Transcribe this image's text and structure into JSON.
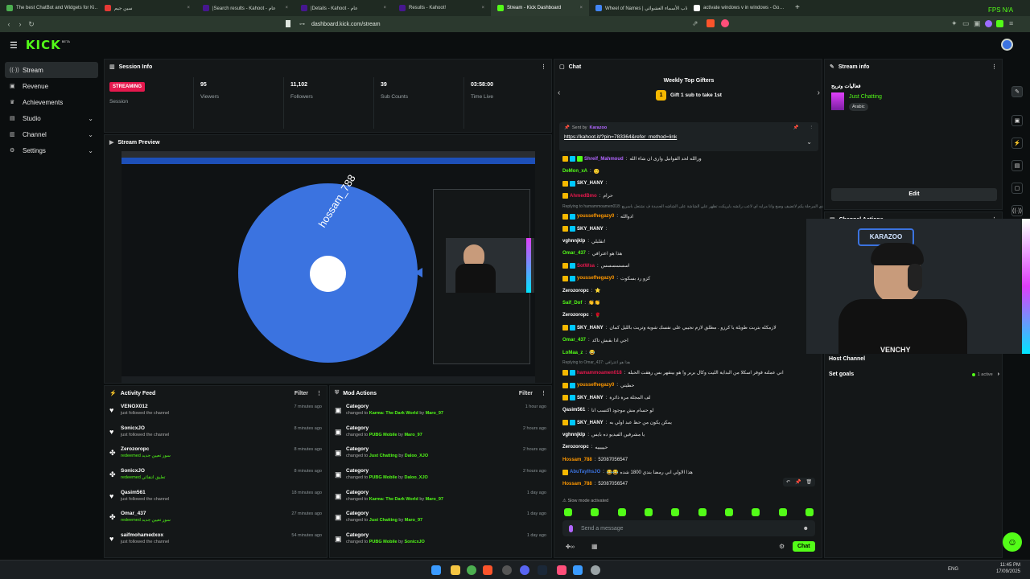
{
  "browser": {
    "tabs": [
      {
        "label": "The best ChatBot and Widgets for Ki…",
        "color": "#4caf50"
      },
      {
        "label": "سين جيم",
        "color": "#e53935"
      },
      {
        "label": "|Search results - Kahoot - عام",
        "color": "#46178f"
      },
      {
        "label": "|Details - Kahoot - عام",
        "color": "#46178f"
      },
      {
        "label": "Results - Kahoot!",
        "color": "#46178f"
      },
      {
        "label": "Stream - Kick Dashboard",
        "color": "#53fc18"
      },
      {
        "label": "Wheel of Names | دوّلاب الأسماء العشوائي",
        "color": "#4285f4"
      },
      {
        "label": "activate windows v in windows - Go…",
        "color": "#ffffff"
      }
    ],
    "url": "dashboard.kick.com/stream",
    "fps_label": "FPS N/A"
  },
  "app": {
    "logo": "KICK",
    "logo_sup": "BETA"
  },
  "sidebar": {
    "items": [
      {
        "label": "Stream",
        "icon": "broadcast-icon",
        "glyph": "((·))",
        "active": true
      },
      {
        "label": "Revenue",
        "icon": "wallet-icon",
        "glyph": "▣"
      },
      {
        "label": "Achievements",
        "icon": "trophy-icon",
        "glyph": "♛"
      },
      {
        "label": "Studio",
        "icon": "studio-icon",
        "glyph": "▤",
        "chevron": true
      },
      {
        "label": "Channel",
        "icon": "channel-icon",
        "glyph": "▥",
        "chevron": true
      },
      {
        "label": "Settings",
        "icon": "gear-icon",
        "glyph": "⚙",
        "chevron": true
      }
    ]
  },
  "session": {
    "title": "Session Info",
    "badge": "STREAMING",
    "session_label": "Session",
    "stats": [
      {
        "value": "95",
        "label": "Viewers"
      },
      {
        "value": "11,102",
        "label": "Followers"
      },
      {
        "value": "39",
        "label": "Sub Counts"
      },
      {
        "value": "03:58:00",
        "label": "Time Live"
      }
    ]
  },
  "preview": {
    "title": "Stream Preview",
    "wheel_name": "hossam_788",
    "wheel_color": "#3b73e0"
  },
  "activity": {
    "title": "Activity Feed",
    "filter": "Filter",
    "items": [
      {
        "name": "VENOX012",
        "sub": "just followed the channel",
        "time": "7 minutes ago",
        "icon": "heart-icon",
        "glyph": "♥"
      },
      {
        "name": "SonicxJO",
        "sub": "just followed the channel",
        "time": "8 minutes ago",
        "icon": "heart-icon",
        "glyph": "♥"
      },
      {
        "name": "Zerozoropc",
        "sub": "redeemed سور تعيين جديد",
        "time": "8 minutes ago",
        "icon": "redeem-icon",
        "glyph": "✤",
        "green": true
      },
      {
        "name": "SonicxJO",
        "sub": "redeemed تعليق انتقائي",
        "time": "8 minutes ago",
        "icon": "redeem-icon",
        "glyph": "✤",
        "green": true
      },
      {
        "name": "Qasim561",
        "sub": "just followed the channel",
        "time": "18 minutes ago",
        "icon": "heart-icon",
        "glyph": "♥"
      },
      {
        "name": "Omar_437",
        "sub": "redeemed سور تعيين جديد",
        "time": "27 minutes ago",
        "icon": "redeem-icon",
        "glyph": "✤",
        "green": true
      },
      {
        "name": "saifmohamedxox",
        "sub": "just followed the channel",
        "time": "54 minutes ago",
        "icon": "heart-icon",
        "glyph": "♥"
      }
    ]
  },
  "mod": {
    "title": "Mod Actions",
    "filter": "Filter",
    "items": [
      {
        "name": "Category",
        "sub_pre": "changed to",
        "target": "Karma: The Dark World",
        "by": "by",
        "user": "Maro_97",
        "time": "1 hour ago"
      },
      {
        "name": "Category",
        "sub_pre": "changed to",
        "target": "PUBG Mobile",
        "by": "by",
        "user": "Maro_97",
        "time": "2 hours ago"
      },
      {
        "name": "Category",
        "sub_pre": "changed to",
        "target": "Just Chatting",
        "by": "by",
        "user": "Daloo_XJO",
        "time": "2 hours ago"
      },
      {
        "name": "Category",
        "sub_pre": "changed to",
        "target": "PUBG Mobile",
        "by": "by",
        "user": "Daloo_XJO",
        "time": "2 hours ago"
      },
      {
        "name": "Category",
        "sub_pre": "changed to",
        "target": "Karma: The Dark World",
        "by": "by",
        "user": "Maro_97",
        "time": "1 day ago"
      },
      {
        "name": "Category",
        "sub_pre": "changed to",
        "target": "Just Chatting",
        "by": "by",
        "user": "Maro_97",
        "time": "1 day ago"
      },
      {
        "name": "Category",
        "sub_pre": "changed to",
        "target": "PUBG Mobile",
        "by": "by",
        "user": "SonicxJO",
        "time": "1 day ago"
      }
    ]
  },
  "chat": {
    "title": "Chat",
    "gifters_title": "Weekly Top Gifters",
    "gifters_sub": "Gift 1 sub to take 1st",
    "pinned_sent_by": "Sent by",
    "pinned_user": "Karazoo",
    "pinned_link": "https://kahoot.it/?pin=783364&refer_method=link",
    "slow_mode": "Slow mode activated",
    "placeholder": "Send a message",
    "send_label": "Chat",
    "lines": [
      {
        "user": "Shreif_Mahmoud",
        "color": "#b266ff",
        "msg": "ورالله لحد الفوانيل وارى ان شاء الله",
        "badges": 3
      },
      {
        "user": "DeMon_xA",
        "color": "#53fc18",
        "msg": "🙂",
        "badges": 0
      },
      {
        "user": "SKY_HANY",
        "color": "#ffffff",
        "msg": "",
        "badges": 2
      },
      {
        "user": "AhmedBmo",
        "color": "#e5184d",
        "msg": "حرام",
        "badges": 1
      },
      {
        "reply": "Replying to hamammoamen018: دي المرحلة يكم لاتضيف وصح وانا مرايه اي لاعب رانشه بايريكت تظهر علي الشاشة على الشاشه الجديدة ف نشتعل باسريع"
      },
      {
        "user": "youssefhegazy0",
        "color": "#ff9800",
        "msg": "ادوالله",
        "badges": 2
      },
      {
        "user": "SKY_HANY",
        "color": "#ffffff",
        "msg": "",
        "badges": 2
      },
      {
        "user": "vghnnjklp",
        "color": "#ffffff",
        "msg": "تقلبلي!",
        "badges": 0
      },
      {
        "user": "Omar_437",
        "color": "#53fc18",
        "msg": "هذا هو اعترافي",
        "badges": 0
      },
      {
        "user": "SotWsa",
        "color": "#e5184d",
        "msg": "اسسسسسس",
        "badges": 2
      },
      {
        "user": "youssefhegazy0",
        "color": "#ff9800",
        "msg": "كزو رد بسكوت",
        "badges": 2
      },
      {
        "user": "Zerozoropc",
        "color": "#ffffff",
        "msg": "⭐",
        "badges": 0
      },
      {
        "user": "Saif_Dof",
        "color": "#53fc18",
        "msg": "👏👏",
        "badges": 0
      },
      {
        "user": "Zerozoropc",
        "color": "#ffffff",
        "msg": "🌹",
        "badges": 0
      },
      {
        "user": "SKY_HANY",
        "color": "#ffffff",
        "msg": "لازمكله بتربت طويلة يا كرزو . مطلق لازم نجيبي على نفسك شوية وتريت بالليل كمان",
        "badges": 2
      },
      {
        "user": "Omar_437",
        "color": "#53fc18",
        "msg": "اجي اذا بقبش تاكد",
        "badges": 0
      },
      {
        "user": "LoMaa_z",
        "color": "#53fc18",
        "msg": "😂",
        "badges": 0
      },
      {
        "reply": "Replying to Omar_437: هذا هو اعترافي"
      },
      {
        "user": "hamammoamen018",
        "color": "#e5184d",
        "msg": "اني عملته قوفر اسكلا من البداية الليت وكال بربر و! هو بينقهر بس رهقت الحبله",
        "badges": 2
      },
      {
        "user": "youssefhegazy0",
        "color": "#ff9800",
        "msg": "حطيتي",
        "badges": 2
      },
      {
        "user": "SKY_HANY",
        "color": "#ffffff",
        "msg": "لف المجلة مرة ذائرة",
        "badges": 2
      },
      {
        "user": "Qasim561",
        "color": "#ffffff",
        "msg": "لو حسام مش موجود اكتسب انا",
        "badges": 0
      },
      {
        "user": "SKY_HANY",
        "color": "#ffffff",
        "msg": "يمكن يكون من حظ عبد اولي به",
        "badges": 2
      },
      {
        "user": "vghnnjklp",
        "color": "#ffffff",
        "msg": "يا مشرفين الفيديو ده بايس",
        "badges": 0
      },
      {
        "user": "Zerozoropc",
        "color": "#ffffff",
        "msg": "حيييييه",
        "badges": 0
      },
      {
        "user": "Hossam_788",
        "color": "#ff9800",
        "msg": "52087056547",
        "badges": 0
      },
      {
        "user": "AbuTaylhsJO",
        "color": "#3b73e0",
        "msg": "😂😂 هذا الاولي اني رمضا بندي 1800 شده",
        "badges": 1
      },
      {
        "user": "Hossam_788",
        "color": "#ff9800",
        "msg": "52087056547",
        "badges": 0
      }
    ]
  },
  "stream_info": {
    "title": "Stream info",
    "stream_title": "فعاليات وتربح",
    "category": "Just Chatting",
    "tag": "Arabic",
    "edit": "Edit"
  },
  "channel_actions": {
    "title": "Channel Actions",
    "host_channel": "Host Channel",
    "set_goals": "Set goals",
    "active": "1 active",
    "webcam_label": "KARAZOO",
    "shirt_text": "VENCHY"
  },
  "taskbar": {
    "lang": "ENG",
    "time": "11:45 PM",
    "date": "17/09/2025"
  }
}
